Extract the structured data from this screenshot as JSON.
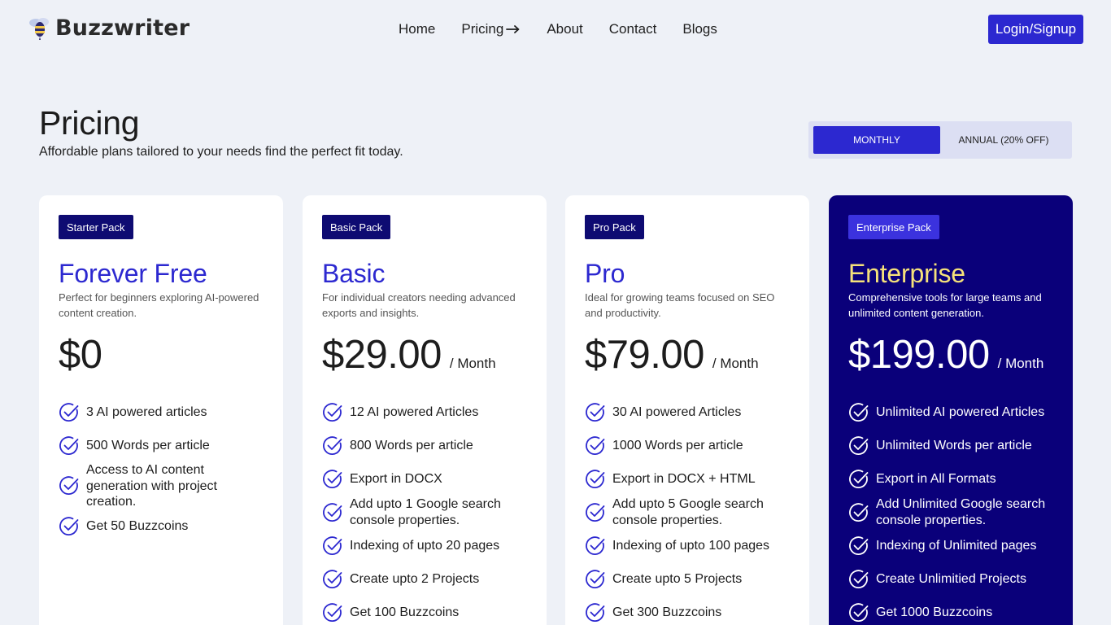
{
  "brand": {
    "name": "Buzzwriter"
  },
  "nav": {
    "items": [
      {
        "label": "Home"
      },
      {
        "label": "Pricing"
      },
      {
        "label": "About"
      },
      {
        "label": "Contact"
      },
      {
        "label": "Blogs"
      }
    ],
    "login_label": "Login/Signup"
  },
  "hero": {
    "title": "Pricing",
    "subtitle": "Affordable plans tailored to your needs find the perfect fit today."
  },
  "billing": {
    "monthly_label": "MONTHLY",
    "annual_label": "ANNUAL (20% OFF)",
    "selected": "monthly"
  },
  "colors": {
    "accent": "#2c28d0",
    "enterprise_bg": "#0a007a",
    "enterprise_title": "#f6e27a",
    "page_bg": "#eef1f7"
  },
  "plans": [
    {
      "badge": "Starter Pack",
      "name": "Forever Free",
      "description": "Perfect for beginners exploring AI-powered content creation.",
      "price": "$0",
      "period": "",
      "features": [
        "3 AI powered articles",
        "500 Words per article",
        "Access to AI content generation with project creation.",
        "Get 50 Buzzcoins"
      ]
    },
    {
      "badge": "Basic Pack",
      "name": "Basic",
      "description": "For individual creators needing advanced exports and insights.",
      "price": "$29.00",
      "period": "/ Month",
      "features": [
        "12 AI powered Articles",
        "800 Words per article",
        "Export in DOCX",
        "Add upto 1 Google search console properties.",
        "Indexing of upto 20 pages",
        "Create upto 2 Projects",
        "Get 100 Buzzcoins"
      ]
    },
    {
      "badge": "Pro Pack",
      "name": "Pro",
      "description": "Ideal for growing teams focused on SEO and productivity.",
      "price": "$79.00",
      "period": "/ Month",
      "features": [
        "30 AI powered Articles",
        "1000 Words per article",
        "Export in DOCX + HTML",
        "Add upto 5 Google search console properties.",
        "Indexing of upto 100 pages",
        "Create upto 5 Projects",
        "Get 300 Buzzcoins"
      ]
    },
    {
      "badge": "Enterprise Pack",
      "name": "Enterprise",
      "description": "Comprehensive tools for large teams and unlimited content generation.",
      "price": "$199.00",
      "period": "/ Month",
      "features": [
        "Unlimited AI powered Articles",
        "Unlimited Words per article",
        "Export in All Formats",
        "Add Unlimited Google search console properties.",
        "Indexing of Unlimited pages",
        "Create Unlimitied Projects",
        "Get 1000 Buzzcoins"
      ]
    }
  ]
}
